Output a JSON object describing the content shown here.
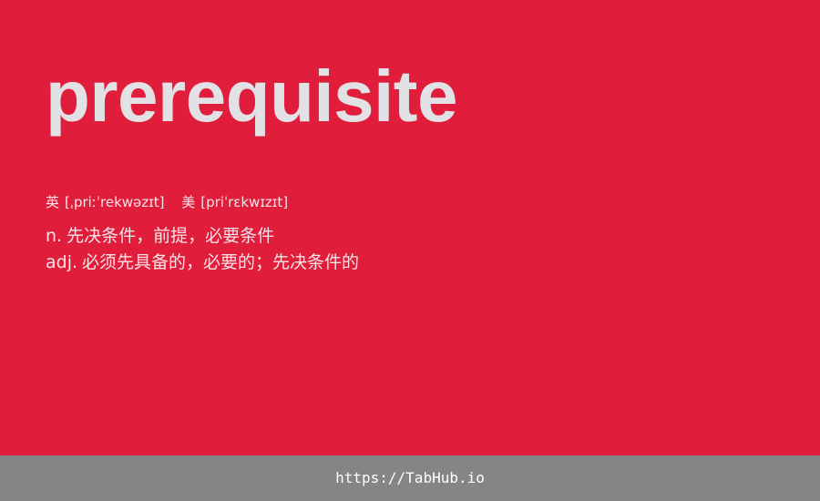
{
  "card": {
    "word": "prerequisite",
    "phonetics": [
      {
        "label": "英",
        "ipa": "[ˌpriːˈrekwəzɪt]"
      },
      {
        "label": "美",
        "ipa": "[priˈrɛkwɪzɪt]"
      }
    ],
    "definitions": [
      {
        "pos": "n.",
        "meaning": "先决条件，前提，必要条件"
      },
      {
        "pos": "adj.",
        "meaning": "必须先具备的，必要的；先决条件的"
      }
    ]
  },
  "footer": {
    "link_text": "https://TabHub.io"
  },
  "colors": {
    "card_background": "#e01e3c",
    "word_text": "#e2e2e6",
    "footer_background": "#858585"
  }
}
